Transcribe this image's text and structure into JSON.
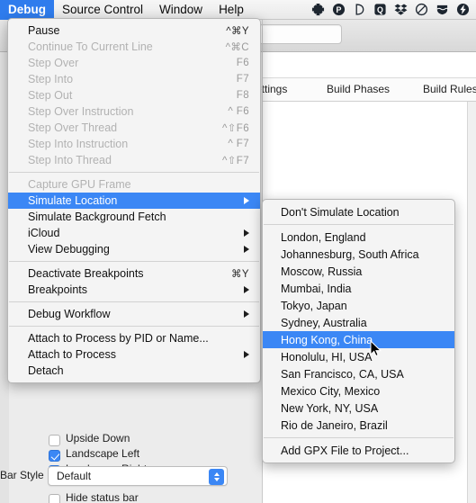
{
  "menubar": {
    "items": [
      {
        "label": "Debug",
        "active": true
      },
      {
        "label": "Source Control",
        "active": false
      },
      {
        "label": "Window",
        "active": false
      },
      {
        "label": "Help",
        "active": false
      }
    ],
    "status_icons": [
      "plus-cross-icon",
      "circle-p-icon",
      "d-shape-icon",
      "square-q-icon",
      "dropbox-icon",
      "circle-slash-icon",
      "shield-waves-icon",
      "lightning-bolt-icon"
    ],
    "highlight_color": "#2f7ced"
  },
  "debug_menu": {
    "groups": [
      {
        "items": [
          {
            "label": "Pause",
            "shortcut": "^⌘Y",
            "enabled": true,
            "submenu": false
          },
          {
            "label": "Continue To Current Line",
            "shortcut": "^⌘C",
            "enabled": false,
            "submenu": false
          },
          {
            "label": "Step Over",
            "shortcut": "F6",
            "enabled": false,
            "submenu": false
          },
          {
            "label": "Step Into",
            "shortcut": "F7",
            "enabled": false,
            "submenu": false
          },
          {
            "label": "Step Out",
            "shortcut": "F8",
            "enabled": false,
            "submenu": false
          },
          {
            "label": "Step Over Instruction",
            "shortcut": "^ F6",
            "enabled": false,
            "submenu": false
          },
          {
            "label": "Step Over Thread",
            "shortcut": "^⇧F6",
            "enabled": false,
            "submenu": false
          },
          {
            "label": "Step Into Instruction",
            "shortcut": "^ F7",
            "enabled": false,
            "submenu": false
          },
          {
            "label": "Step Into Thread",
            "shortcut": "^⇧F7",
            "enabled": false,
            "submenu": false
          }
        ]
      },
      {
        "items": [
          {
            "label": "Capture GPU Frame",
            "shortcut": "",
            "enabled": false,
            "submenu": false
          },
          {
            "label": "Simulate Location",
            "shortcut": "",
            "enabled": true,
            "submenu": true,
            "selected": true
          },
          {
            "label": "Simulate Background Fetch",
            "shortcut": "",
            "enabled": true,
            "submenu": false
          },
          {
            "label": "iCloud",
            "shortcut": "",
            "enabled": true,
            "submenu": true
          },
          {
            "label": "View Debugging",
            "shortcut": "",
            "enabled": true,
            "submenu": true
          }
        ]
      },
      {
        "items": [
          {
            "label": "Deactivate Breakpoints",
            "shortcut": "⌘Y",
            "enabled": true,
            "submenu": false
          },
          {
            "label": "Breakpoints",
            "shortcut": "",
            "enabled": true,
            "submenu": true
          }
        ]
      },
      {
        "items": [
          {
            "label": "Debug Workflow",
            "shortcut": "",
            "enabled": true,
            "submenu": true
          }
        ]
      },
      {
        "items": [
          {
            "label": "Attach to Process by PID or Name...",
            "shortcut": "",
            "enabled": true,
            "submenu": false
          },
          {
            "label": "Attach to Process",
            "shortcut": "",
            "enabled": true,
            "submenu": true
          },
          {
            "label": "Detach",
            "shortcut": "",
            "enabled": true,
            "submenu": false
          }
        ]
      }
    ]
  },
  "location_submenu": {
    "groups": [
      {
        "items": [
          {
            "label": "Don't Simulate Location",
            "selected": false
          }
        ]
      },
      {
        "items": [
          {
            "label": "London, England",
            "selected": false
          },
          {
            "label": "Johannesburg, South Africa",
            "selected": false
          },
          {
            "label": "Moscow, Russia",
            "selected": false
          },
          {
            "label": "Mumbai, India",
            "selected": false
          },
          {
            "label": "Tokyo, Japan",
            "selected": false
          },
          {
            "label": "Sydney, Australia",
            "selected": false
          },
          {
            "label": "Hong Kong, China",
            "selected": true
          },
          {
            "label": "Honolulu, HI, USA",
            "selected": false
          },
          {
            "label": "San Francisco, CA, USA",
            "selected": false
          },
          {
            "label": "Mexico City, Mexico",
            "selected": false
          },
          {
            "label": "New York, NY, USA",
            "selected": false
          },
          {
            "label": "Rio de Janeiro, Brazil",
            "selected": false
          }
        ]
      },
      {
        "items": [
          {
            "label": "Add GPX File to Project...",
            "selected": false
          }
        ]
      }
    ],
    "highlight_color": "#3b87f5"
  },
  "background": {
    "tabs": [
      {
        "label": "Settings"
      },
      {
        "label": "Build Phases"
      },
      {
        "label": "Build Rules"
      }
    ],
    "inspector": {
      "orientation_checkboxes": [
        {
          "label": "Upside Down",
          "checked": false
        },
        {
          "label": "Landscape Left",
          "checked": true
        },
        {
          "label": "Landscape Right",
          "checked": true
        }
      ],
      "bar_style_label": "Bar Style",
      "bar_style_value": "Default",
      "hide_status_bar_label": "Hide status bar",
      "hide_status_bar_checked": false
    },
    "toolbar_field_value": ""
  }
}
